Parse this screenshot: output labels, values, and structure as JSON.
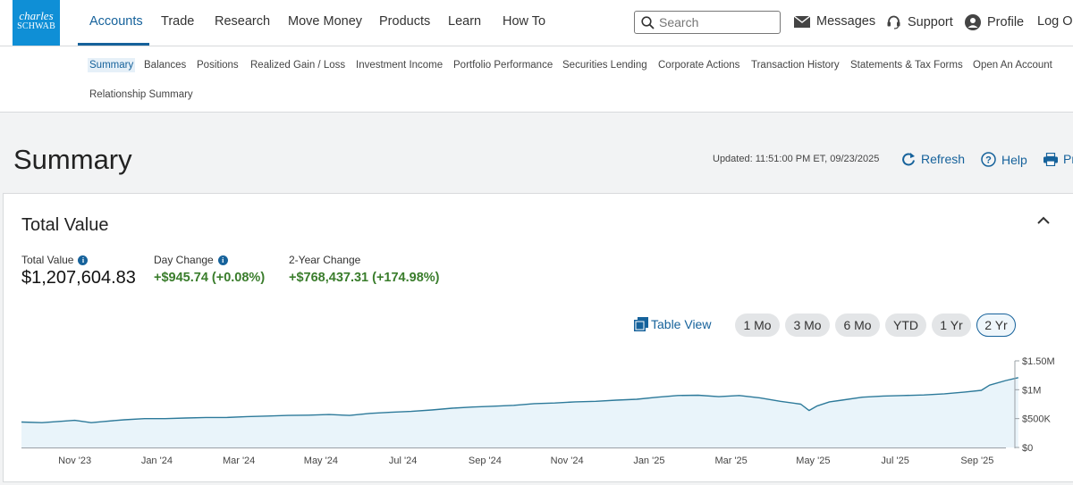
{
  "brand": {
    "line1": "charles",
    "line2": "SCHWAB"
  },
  "nav": {
    "items": [
      "Accounts",
      "Trade",
      "Research",
      "Move Money",
      "Products",
      "Learn",
      "How To"
    ]
  },
  "search": {
    "placeholder": "Search"
  },
  "utility": {
    "messages": "Messages",
    "support": "Support",
    "profile": "Profile",
    "logout": "Log Out"
  },
  "subnav": {
    "items": [
      "Summary",
      "Balances",
      "Positions",
      "Realized Gain / Loss",
      "Investment Income",
      "Portfolio Performance",
      "Securities Lending",
      "Corporate Actions",
      "Transaction History",
      "Statements & Tax Forms",
      "Open An Account",
      "Relationship Summary"
    ]
  },
  "page": {
    "title": "Summary",
    "updated": "Updated: 11:51:00 PM ET, 09/23/2025",
    "refresh": "Refresh",
    "help": "Help",
    "print": "Print"
  },
  "card": {
    "title": "Total Value",
    "total_value_label": "Total Value",
    "total_value": "$1,207,604.83",
    "day_change_label": "Day Change",
    "day_change": "+$945.74 (+0.08%)",
    "two_year_label": "2-Year Change",
    "two_year_change": "+$768,437.31 (+174.98%)",
    "table_view": "Table View",
    "ranges": [
      "1 Mo",
      "3 Mo",
      "6 Mo",
      "YTD",
      "1 Yr",
      "2 Yr"
    ],
    "active_range": "2 Yr"
  },
  "colors": {
    "accent": "#16629b",
    "gain": "#3a7d2c",
    "line": "#2d7a9a",
    "fill": "#e9f4fa",
    "logo": "#0f8fd6"
  },
  "chart_data": {
    "type": "area",
    "x_tick_labels": [
      "Nov '23",
      "Jan '24",
      "Mar '24",
      "May '24",
      "Jul '24",
      "Sep '24",
      "Nov '24",
      "Jan '25",
      "Mar '25",
      "May '25",
      "Jul '25",
      "Sep '25"
    ],
    "y_tick_labels": [
      "$1.50M",
      "$1M",
      "$500K",
      "$0"
    ],
    "y_ticks": [
      1500000,
      1000000,
      500000,
      0
    ],
    "ylim": [
      0,
      1500000
    ],
    "x_unit": "months since Sep 23, 2023",
    "xlim": [
      0,
      24
    ],
    "series": [
      {
        "values": [
          [
            0.0,
            440000
          ],
          [
            0.5,
            430000
          ],
          [
            1.0,
            455000
          ],
          [
            1.3,
            470000
          ],
          [
            1.7,
            430000
          ],
          [
            2.0,
            450000
          ],
          [
            2.5,
            480000
          ],
          [
            3.0,
            500000
          ],
          [
            3.5,
            500000
          ],
          [
            4.0,
            510000
          ],
          [
            4.5,
            520000
          ],
          [
            5.0,
            520000
          ],
          [
            5.5,
            535000
          ],
          [
            6.0,
            545000
          ],
          [
            6.5,
            555000
          ],
          [
            7.0,
            560000
          ],
          [
            7.5,
            570000
          ],
          [
            8.0,
            555000
          ],
          [
            8.5,
            590000
          ],
          [
            9.0,
            610000
          ],
          [
            9.5,
            625000
          ],
          [
            10.0,
            650000
          ],
          [
            10.5,
            680000
          ],
          [
            11.0,
            700000
          ],
          [
            11.5,
            715000
          ],
          [
            12.0,
            730000
          ],
          [
            12.5,
            760000
          ],
          [
            13.0,
            770000
          ],
          [
            13.5,
            790000
          ],
          [
            14.0,
            800000
          ],
          [
            14.5,
            820000
          ],
          [
            15.0,
            835000
          ],
          [
            15.5,
            870000
          ],
          [
            16.0,
            900000
          ],
          [
            16.5,
            905000
          ],
          [
            17.0,
            880000
          ],
          [
            17.5,
            900000
          ],
          [
            18.0,
            860000
          ],
          [
            18.5,
            800000
          ],
          [
            19.0,
            750000
          ],
          [
            19.2,
            640000
          ],
          [
            19.4,
            720000
          ],
          [
            19.7,
            790000
          ],
          [
            20.0,
            820000
          ],
          [
            20.5,
            870000
          ],
          [
            21.0,
            890000
          ],
          [
            21.5,
            900000
          ],
          [
            22.0,
            910000
          ],
          [
            22.5,
            930000
          ],
          [
            23.0,
            960000
          ],
          [
            23.4,
            990000
          ],
          [
            23.6,
            1080000
          ],
          [
            24.0,
            1160000
          ],
          [
            24.3,
            1210000
          ]
        ]
      }
    ],
    "grid": false,
    "legend": "none"
  }
}
